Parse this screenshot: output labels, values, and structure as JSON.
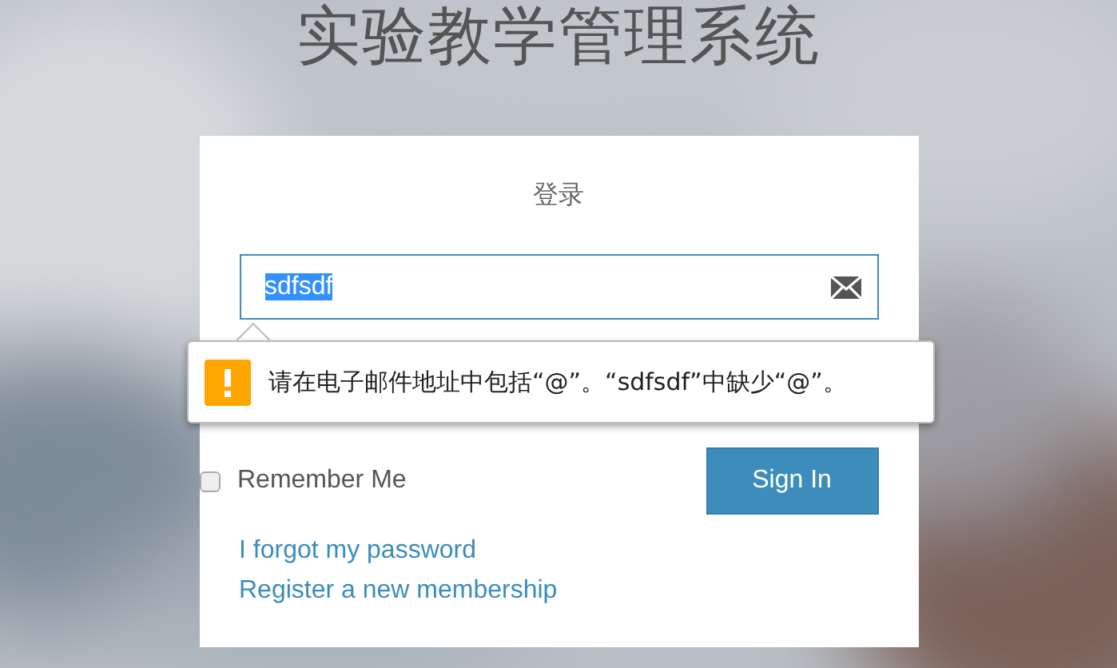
{
  "page": {
    "title": "实验教学管理系统"
  },
  "login": {
    "heading": "登录",
    "email_field": {
      "value": "sdfsdf"
    },
    "validation_tooltip": {
      "message": "请在电子邮件地址中包括“@”。“sdfsdf”中缺少“@”。"
    },
    "remember_me": {
      "label": "Remember Me",
      "checked": false
    },
    "sign_in_button": "Sign In",
    "links": [
      "I forgot my password",
      "Register a new membership"
    ]
  }
}
